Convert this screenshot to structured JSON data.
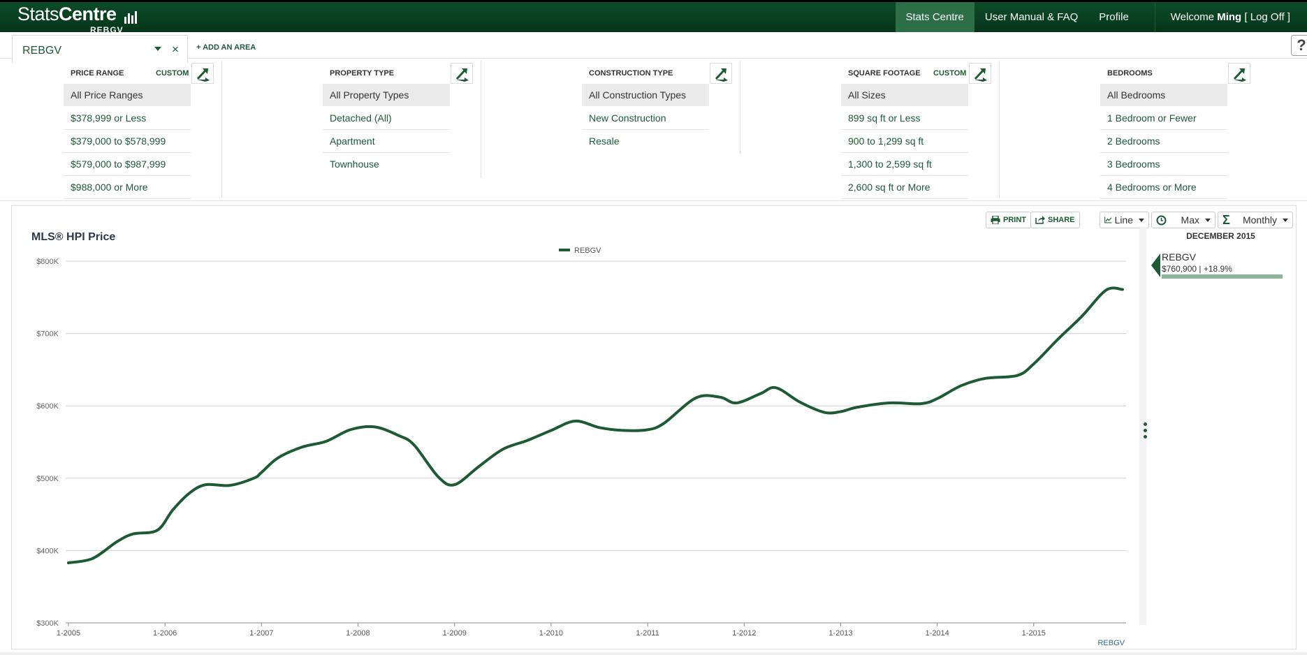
{
  "header": {
    "logo_text": "Stats",
    "logo_bold": "Centre",
    "logo_sub": "REBGV",
    "nav": [
      {
        "label": "Stats Centre",
        "active": true
      },
      {
        "label": "User Manual & FAQ",
        "active": false
      },
      {
        "label": "Profile",
        "active": false
      }
    ],
    "welcome_prefix": "Welcome",
    "welcome_user": "Ming",
    "logoff": "[ Log Off ]"
  },
  "area": {
    "selected": "REBGV",
    "close": "×",
    "add_label": "+ ADD AN AREA",
    "help": "?"
  },
  "filters": [
    {
      "title": "PRICE RANGE",
      "custom": "CUSTOM",
      "options": [
        "All Price Ranges",
        "$378,999 or Less",
        "$379,000 to $578,999",
        "$579,000 to $987,999",
        "$988,000 or More"
      ]
    },
    {
      "title": "PROPERTY TYPE",
      "custom": "",
      "options": [
        "All Property Types",
        "Detached (All)",
        "Apartment",
        "Townhouse"
      ]
    },
    {
      "title": "CONSTRUCTION TYPE",
      "custom": "",
      "options": [
        "All Construction Types",
        "New Construction",
        "Resale"
      ]
    },
    {
      "title": "SQUARE FOOTAGE",
      "custom": "CUSTOM",
      "options": [
        "All Sizes",
        "899 sq ft or Less",
        "900 to 1,299 sq ft",
        "1,300 to 2,599 sq ft",
        "2,600 sq ft or More"
      ]
    },
    {
      "title": "BEDROOMS",
      "custom": "",
      "options": [
        "All Bedrooms",
        "1 Bedroom or Fewer",
        "2 Bedrooms",
        "3 Bedrooms",
        "4 Bedrooms or More"
      ]
    }
  ],
  "toolbar": {
    "print": "PRINT",
    "share": "SHARE",
    "chart_type": "Line",
    "range": "Max",
    "frequency": "Monthly"
  },
  "side": {
    "month": "DECEMBER 2015",
    "name": "REBGV",
    "value": "$760,900 | +18.9%"
  },
  "colors": {
    "brand_dark": "#06341a",
    "brand": "#1d5a35",
    "line": "#1d5a35"
  },
  "chart_data": {
    "type": "line",
    "title": "MLS® HPI Price",
    "source_label": "REBGV",
    "y_ticks": [
      "$300K",
      "$400K",
      "$500K",
      "$600K",
      "$700K",
      "$800K"
    ],
    "ylim": [
      300000,
      800000
    ],
    "x_ticks": [
      "1-2005",
      "1-2006",
      "1-2007",
      "1-2008",
      "1-2009",
      "1-2010",
      "1-2011",
      "1-2012",
      "1-2013",
      "1-2014",
      "1-2015"
    ],
    "grid": true,
    "legend_position": "top-center",
    "series": [
      {
        "name": "REBGV",
        "x": [
          2005.0,
          2005.25,
          2005.5,
          2005.67,
          2005.92,
          2006.08,
          2006.25,
          2006.42,
          2006.67,
          2006.92,
          2007.0,
          2007.17,
          2007.42,
          2007.67,
          2007.92,
          2008.17,
          2008.42,
          2008.58,
          2008.83,
          2009.0,
          2009.25,
          2009.5,
          2009.75,
          2010.0,
          2010.25,
          2010.5,
          2010.75,
          2011.0,
          2011.17,
          2011.5,
          2011.75,
          2011.92,
          2012.17,
          2012.33,
          2012.58,
          2012.83,
          2013.0,
          2013.17,
          2013.5,
          2013.83,
          2014.0,
          2014.25,
          2014.5,
          2014.83,
          2015.0,
          2015.25,
          2015.5,
          2015.75,
          2015.92
        ],
        "values": [
          383000,
          389000,
          412000,
          423000,
          428000,
          456000,
          479000,
          491000,
          490000,
          500000,
          508000,
          528000,
          543000,
          551000,
          567000,
          571000,
          559000,
          546000,
          502000,
          491000,
          516000,
          540000,
          552000,
          566000,
          579000,
          570000,
          566000,
          567000,
          576000,
          611000,
          612000,
          604000,
          617000,
          625000,
          605000,
          591000,
          592000,
          598000,
          604000,
          603000,
          610000,
          628000,
          638000,
          642000,
          658000,
          692000,
          724000,
          760000,
          760900
        ]
      }
    ]
  }
}
